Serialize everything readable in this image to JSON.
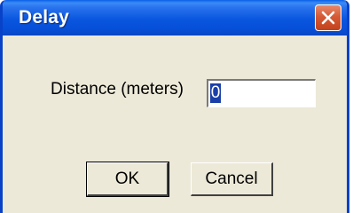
{
  "window": {
    "title": "Delay"
  },
  "form": {
    "distance_label": "Distance (meters)",
    "distance_value": "0"
  },
  "buttons": {
    "ok_label": "OK",
    "cancel_label": "Cancel"
  },
  "icons": {
    "close": "close-icon"
  },
  "colors": {
    "titlebar": "#0a56df",
    "close_button": "#d55a35",
    "dialog_background": "#ece9d8",
    "selection": "#1a3fa8"
  }
}
